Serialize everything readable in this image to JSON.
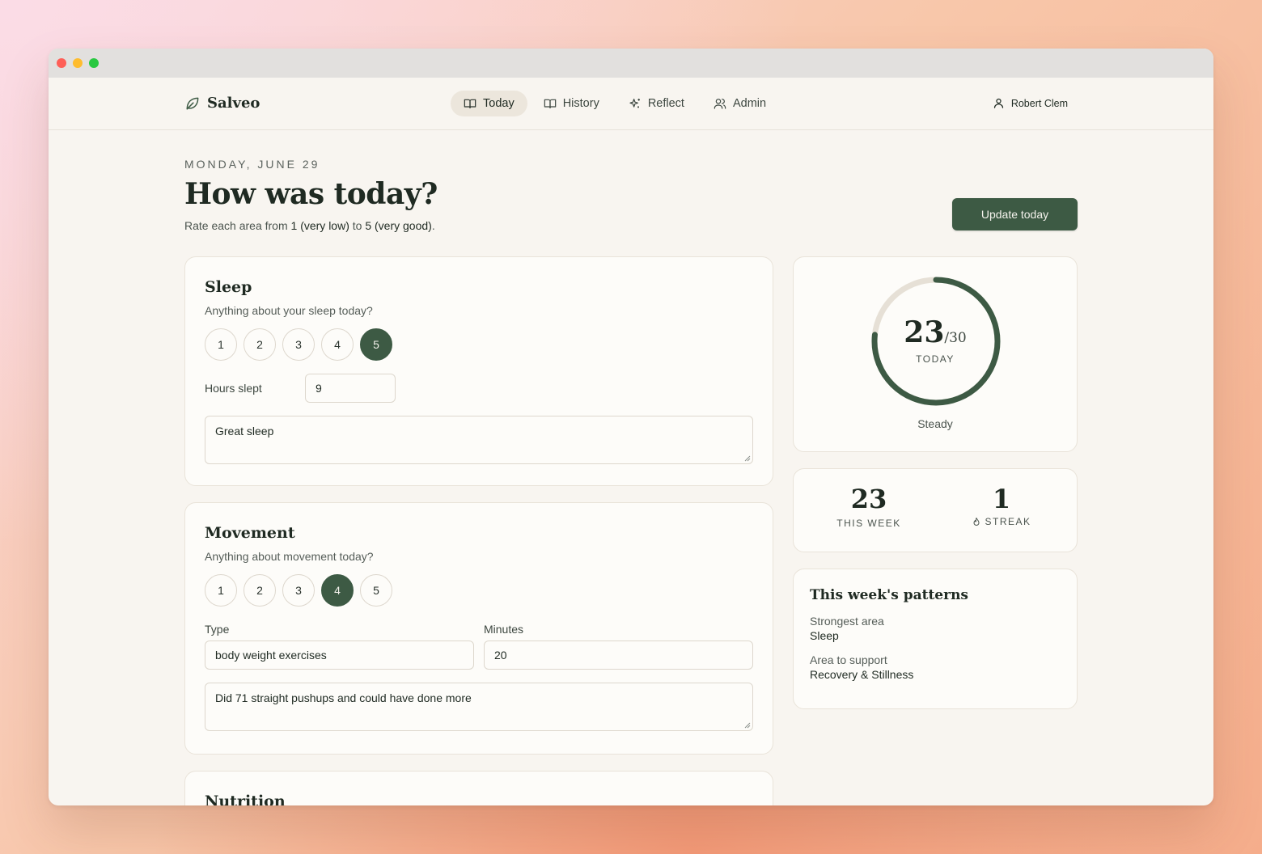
{
  "app": {
    "name": "Salveo",
    "user": "Robert Clem",
    "nav": [
      {
        "label": "Today",
        "active": true
      },
      {
        "label": "History",
        "active": false
      },
      {
        "label": "Reflect",
        "active": false
      },
      {
        "label": "Admin",
        "active": false
      }
    ],
    "accent": "#3d5a44"
  },
  "header": {
    "date": "MONDAY, JUNE 29",
    "title": "How was today?",
    "subtitle_pre": "Rate each area from ",
    "low": "1 (very low)",
    "mid": " to ",
    "high": "5 (very good)",
    "end": ".",
    "update_button": "Update today"
  },
  "sleep": {
    "title": "Sleep",
    "prompt": "Anything about your sleep today?",
    "ratings": [
      "1",
      "2",
      "3",
      "4",
      "5"
    ],
    "selected": 5,
    "hours_label": "Hours slept",
    "hours_value": "9",
    "note": "Great sleep"
  },
  "movement": {
    "title": "Movement",
    "prompt": "Anything about movement today?",
    "ratings": [
      "1",
      "2",
      "3",
      "4",
      "5"
    ],
    "selected": 4,
    "type_label": "Type",
    "type_value": "body weight exercises",
    "minutes_label": "Minutes",
    "minutes_value": "20",
    "note": "Did 71 straight pushups and could have done more"
  },
  "nutrition": {
    "title": "Nutrition"
  },
  "score": {
    "value": "23",
    "max": "/30",
    "fraction": 0.7667,
    "label": "TODAY",
    "status": "Steady"
  },
  "stats": {
    "week_value": "23",
    "week_label": "THIS WEEK",
    "streak_value": "1",
    "streak_label": "STREAK"
  },
  "patterns": {
    "title": "This week's patterns",
    "strongest_label": "Strongest area",
    "strongest_value": "Sleep",
    "support_label": "Area to support",
    "support_value": "Recovery & Stillness"
  }
}
